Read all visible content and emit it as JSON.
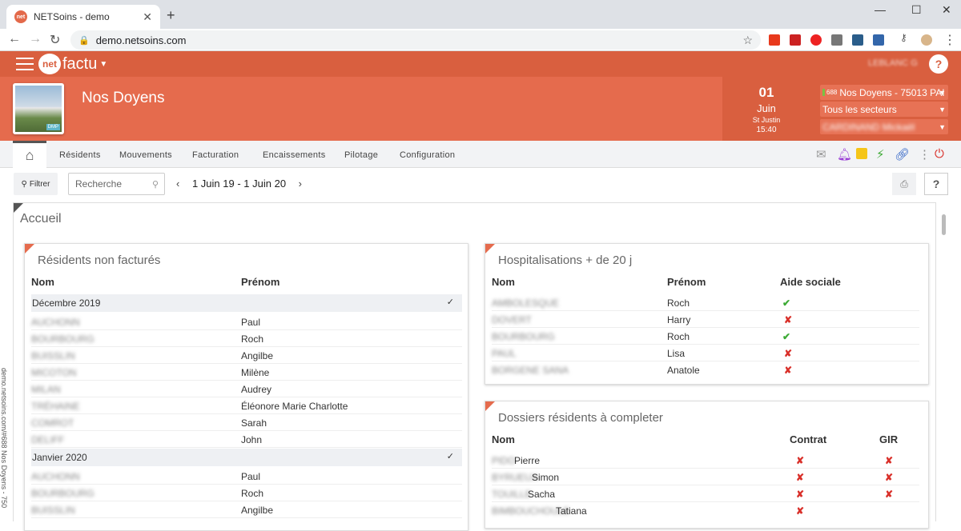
{
  "browser": {
    "tab_title": "NETSoins - demo",
    "url": "demo.netsoins.com"
  },
  "app": {
    "brand_left": "net",
    "brand_right": "factu",
    "username": "LEBLANC G",
    "help": "?"
  },
  "establishment": {
    "name": "Nos Doyens",
    "photo_tag": "DMP"
  },
  "date": {
    "day": "01",
    "month": "Juin",
    "saint": "St Justin",
    "time": "15:40"
  },
  "selectors": {
    "establishment_num": "688",
    "establishment": "Nos Doyens - 75013 PAI",
    "sector": "Tous les secteurs",
    "user": "CARDINAND Mickaël"
  },
  "menu": {
    "items": [
      "Résidents",
      "Mouvements",
      "Facturation",
      "Encaissements",
      "Pilotage",
      "Configuration"
    ]
  },
  "toolbar": {
    "filter_label": "Filtrer",
    "search_placeholder": "Recherche",
    "period": "1 Juin 19 - 1 Juin 20"
  },
  "main": {
    "title": "Accueil",
    "side_url": "demo.netsoins.com/#688 Nos Doyens - 750"
  },
  "non_factures": {
    "title": "Résidents non facturés",
    "col_nom": "Nom",
    "col_prenom": "Prénom",
    "groups": [
      {
        "label": "Décembre 2019",
        "rows": [
          {
            "nom": "AUCHONN",
            "prenom": "Paul"
          },
          {
            "nom": "BOURBOURG",
            "prenom": "Roch"
          },
          {
            "nom": "BUISSLIN",
            "prenom": "Angilbe"
          },
          {
            "nom": "MICOTON",
            "prenom": "Milène"
          },
          {
            "nom": "MILAN",
            "prenom": "Audrey"
          },
          {
            "nom": "TRÉHAINE",
            "prenom": "Éléonore Marie Charlotte"
          },
          {
            "nom": "COMROT",
            "prenom": "Sarah"
          },
          {
            "nom": "DELIFF",
            "prenom": "John"
          }
        ]
      },
      {
        "label": "Janvier 2020",
        "rows": [
          {
            "nom": "AUCHONN",
            "prenom": "Paul"
          },
          {
            "nom": "BOURBOURG",
            "prenom": "Roch"
          },
          {
            "nom": "BUISSLIN",
            "prenom": "Angilbe"
          }
        ]
      }
    ]
  },
  "hospitalisations": {
    "title": "Hospitalisations + de 20 j",
    "col_nom": "Nom",
    "col_prenom": "Prénom",
    "col_aide": "Aide sociale",
    "rows": [
      {
        "nom": "AMBOLESQUE",
        "prenom": "Roch",
        "aide": "✔"
      },
      {
        "nom": "DOVERT",
        "prenom": "Harry",
        "aide": "✘"
      },
      {
        "nom": "BOURBOURG",
        "prenom": "Roch",
        "aide": "✔"
      },
      {
        "nom": "PAUL",
        "prenom": "Lisa",
        "aide": "✘"
      },
      {
        "nom": "BORGENE SANA",
        "prenom": "Anatole",
        "aide": "✘"
      }
    ]
  },
  "dossiers": {
    "title": "Dossiers résidents à completer",
    "col_nom": "Nom",
    "col_contrat": "Contrat",
    "col_gir": "GIR",
    "rows": [
      {
        "nom": "PIDO",
        "prenom": "Pierre",
        "contrat": "✘",
        "gir": "✘"
      },
      {
        "nom": "BYRUEUX",
        "prenom": "Simon",
        "contrat": "✘",
        "gir": "✘"
      },
      {
        "nom": "TOUILLE",
        "prenom": "Sacha",
        "contrat": "✘",
        "gir": "✘"
      },
      {
        "nom": "BIMBOUCHOULE",
        "prenom": "Tatiana",
        "contrat": "✘",
        "gir": ""
      }
    ]
  }
}
